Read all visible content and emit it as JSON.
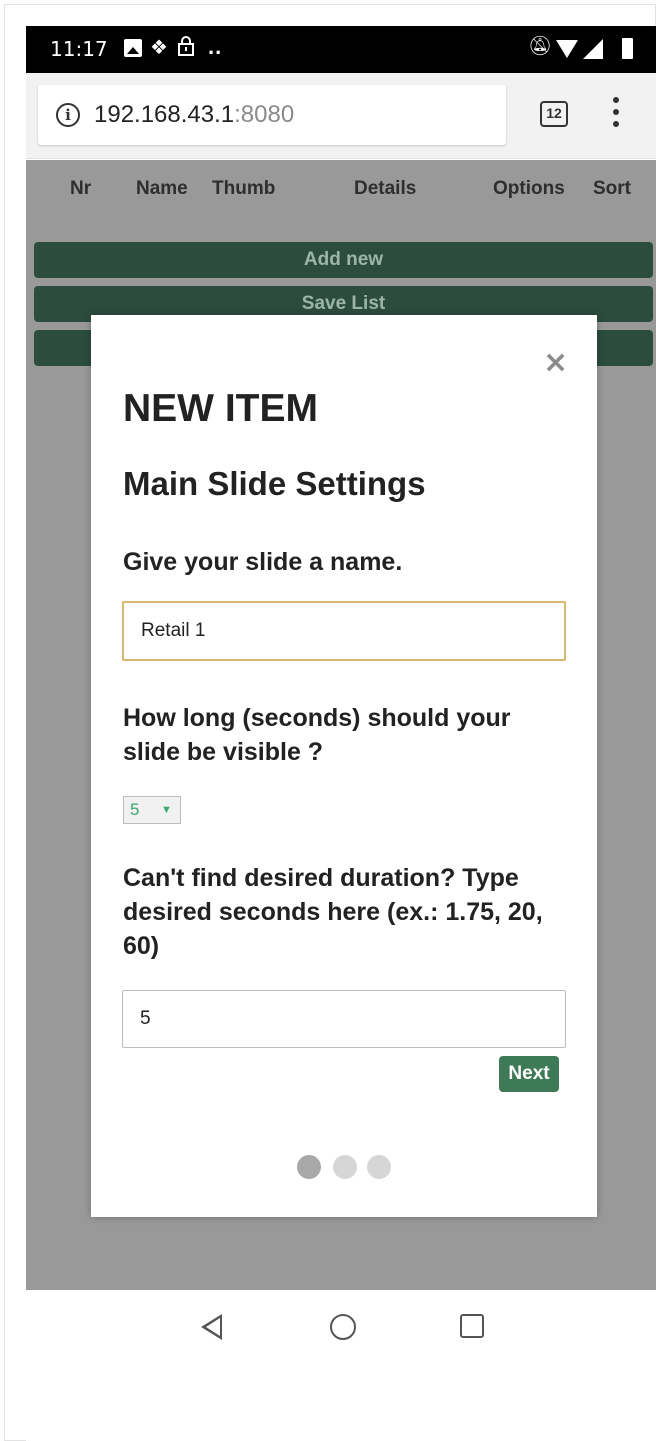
{
  "status_bar": {
    "time": "11:17",
    "icons": [
      "image-icon",
      "dropbox-icon",
      "lock-icon",
      "more-notifications-icon",
      "notifications-muted-icon",
      "wifi-icon",
      "signal-icon",
      "battery-icon"
    ]
  },
  "browser": {
    "url_host": "192.168.43.1",
    "url_port": ":8080",
    "tab_count": "12"
  },
  "table_header": {
    "columns": [
      "Nr",
      "Name",
      "Thumb",
      "Details",
      "Options",
      "Sort"
    ]
  },
  "page_buttons": {
    "add_new": "Add new",
    "save_list": "Save List",
    "third": ""
  },
  "modal": {
    "close_glyph": "×",
    "title": "NEW ITEM",
    "subtitle": "Main Slide Settings",
    "name_question": "Give your slide a name.",
    "name_value": "Retail 1",
    "duration_question": "How long (seconds) should your slide be visible ?",
    "duration_selected": "5",
    "custom_question": "Can't find desired duration? Type desired seconds here (ex.: 1.75, 20, 60)",
    "custom_value": "5",
    "next_label": "Next",
    "steps": {
      "total": 3,
      "current": 1
    }
  },
  "colors": {
    "overlay": "#999999",
    "button_dark_green": "#2c4d3e",
    "next_button": "#3d7a55",
    "name_input_border": "#d8b770"
  }
}
